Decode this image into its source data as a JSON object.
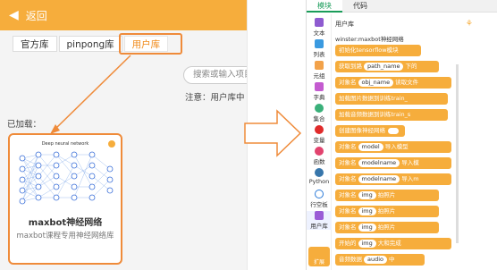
{
  "left": {
    "back_label": "返回",
    "tabs": [
      "官方库",
      "pinpong库",
      "用户库"
    ],
    "search_placeholder": "搜索或输入项目",
    "note": "注意：用户库中",
    "loaded_label": "已加载：",
    "card": {
      "thumb_title": "Deep neural network",
      "title": "maxbot神经网络",
      "desc": "maxbot课程专用神经网络库"
    }
  },
  "right": {
    "tabs": [
      "模块",
      "代码"
    ],
    "categories": [
      "文本",
      "列表",
      "元组",
      "字典",
      "集合",
      "变量",
      "函数",
      "Python",
      "行空板",
      "用户库"
    ],
    "block_header": "用户库",
    "lib_name": "winster:maxbot神经网络",
    "blocks": [
      {
        "pre": "初始化tensorflow模块",
        "pill": "",
        "post": ""
      },
      {
        "pre": "获取到路",
        "pill": "path_name",
        "post": "下的"
      },
      {
        "pre": "对象名",
        "pill": "obj_name",
        "post": "读取文件"
      },
      {
        "pre": "加载图片数据到训练",
        "pill": "",
        "post": "train_"
      },
      {
        "pre": "加载音频数据到训练",
        "pill": "",
        "post": "train_s"
      },
      {
        "pre": "创建图像神经网络",
        "pill": "",
        "post": ""
      },
      {
        "pre": "对象名",
        "pill": "model",
        "post": "导入模型"
      },
      {
        "pre": "对象名",
        "pill": "modelname",
        "post": "导入模"
      },
      {
        "pre": "对象名",
        "pill": "modelname",
        "post": "导入m"
      },
      {
        "pre": "对象名",
        "pill": "img",
        "post": "拍照片"
      },
      {
        "pre": "对象名",
        "pill": "img",
        "post": "拍照片"
      },
      {
        "pre": "对象名",
        "pill": "img",
        "post": "拍照片"
      },
      {
        "pre": "开始的",
        "pill": "img",
        "post": "大和完成"
      },
      {
        "pre": "音频数据",
        "pill": "audio",
        "post": "中"
      }
    ],
    "last_cat_label": "扩展"
  }
}
